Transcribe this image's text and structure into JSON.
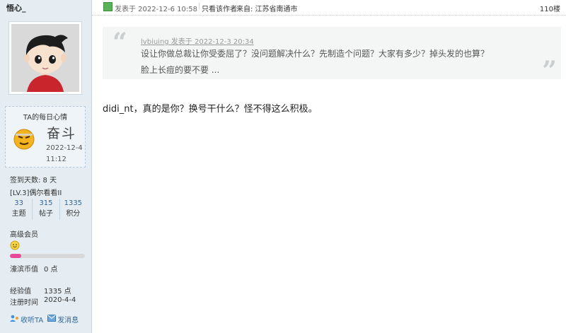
{
  "user": {
    "name": "悟心_",
    "mood": {
      "title": "TA的每日心情",
      "word": "奋斗",
      "date": "2022-12-4",
      "time": "11:12"
    },
    "signin": "签到天数: 8 天",
    "level": "[LV.3]偶尔看看II",
    "stats": [
      {
        "num": "33",
        "label": "主题"
      },
      {
        "num": "315",
        "label": "帖子"
      },
      {
        "num": "1335",
        "label": "积分"
      }
    ],
    "group": "高级会员",
    "group_progress": 0.15,
    "coins": {
      "label": "濠滨币值",
      "value": "0 点"
    },
    "exp": {
      "label": "经验值",
      "value": "1335 点"
    },
    "regtime": {
      "label": "注册时间",
      "value": "2020-4-4"
    },
    "actions": {
      "follow": "收听TA",
      "message": "发消息"
    }
  },
  "post": {
    "posted_at": "发表于 2022-12-6 10:58",
    "only_author": "只看该作者",
    "from": "来自: 江苏省南通市",
    "floor": "110楼",
    "quote": {
      "meta": "lvbiuing 发表于 2022-12-3 20:34",
      "line1": "设让你做总裁让你受委屈了？没问题解决什么？先制造个问题？大家有多少？掉头发的也算？",
      "line2": "脸上长痘的要不要 ..."
    },
    "reply": "didi_nt，真的是你？换号干什么？怪不得这么积极。"
  },
  "colors": {
    "sidebar_bg": "#e5edf2",
    "accent_link": "#336699",
    "progress_fill": "#e8489a"
  }
}
